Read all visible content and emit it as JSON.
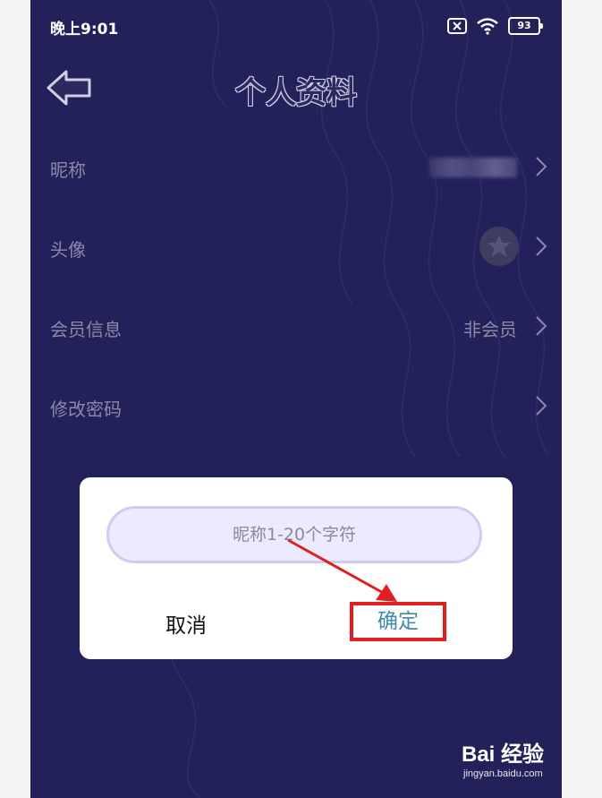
{
  "status_bar": {
    "time": "晚上9:01",
    "battery": "93"
  },
  "header": {
    "title": "个人资料"
  },
  "rows": [
    {
      "label": "昵称",
      "value": ""
    },
    {
      "label": "头像",
      "value": ""
    },
    {
      "label": "会员信息",
      "value": "非会员"
    },
    {
      "label": "修改密码",
      "value": ""
    }
  ],
  "dialog": {
    "input_placeholder": "昵称1-20个字符",
    "cancel_label": "取消",
    "confirm_label": "确定"
  },
  "watermark": {
    "logo": "Bai 经验",
    "url": "jingyan.baidu.com"
  },
  "colors": {
    "background": "#23215a",
    "highlight": "#e02020",
    "confirm_text": "#3e8ca8"
  }
}
